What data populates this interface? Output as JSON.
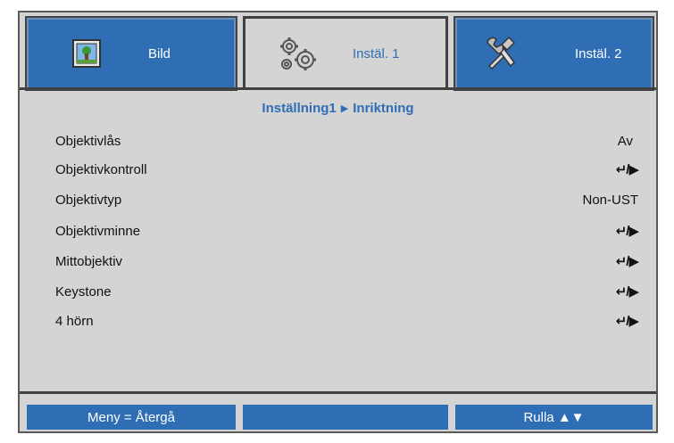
{
  "tabs": [
    {
      "label": "Bild",
      "icon": "image-icon",
      "active": false
    },
    {
      "label": "Instäl. 1",
      "icon": "gears-icon",
      "active": true
    },
    {
      "label": "Instäl. 2",
      "icon": "tools-icon",
      "active": false
    }
  ],
  "breadcrumb": {
    "parent": "Inställning1",
    "separator": "▶",
    "current": "Inriktning"
  },
  "menu_items": [
    {
      "label": "Objektivlås",
      "value": "Av"
    },
    {
      "label": "Objektivkontroll",
      "value": "↵/▶"
    },
    {
      "label": "Objektivtyp",
      "value": "Non-UST"
    },
    {
      "label": "Objektivminne",
      "value": "↵/▶"
    },
    {
      "label": "Mittobjektiv",
      "value": "↵/▶"
    },
    {
      "label": "Keystone",
      "value": "↵/▶"
    },
    {
      "label": "4 hörn",
      "value": "↵/▶"
    }
  ],
  "footer": {
    "left": "Meny = Återgå",
    "middle": "",
    "right": "Rulla ▲▼"
  },
  "colors": {
    "accent": "#2f6eb5",
    "panel": "#d4d4d4",
    "border": "#404040"
  }
}
